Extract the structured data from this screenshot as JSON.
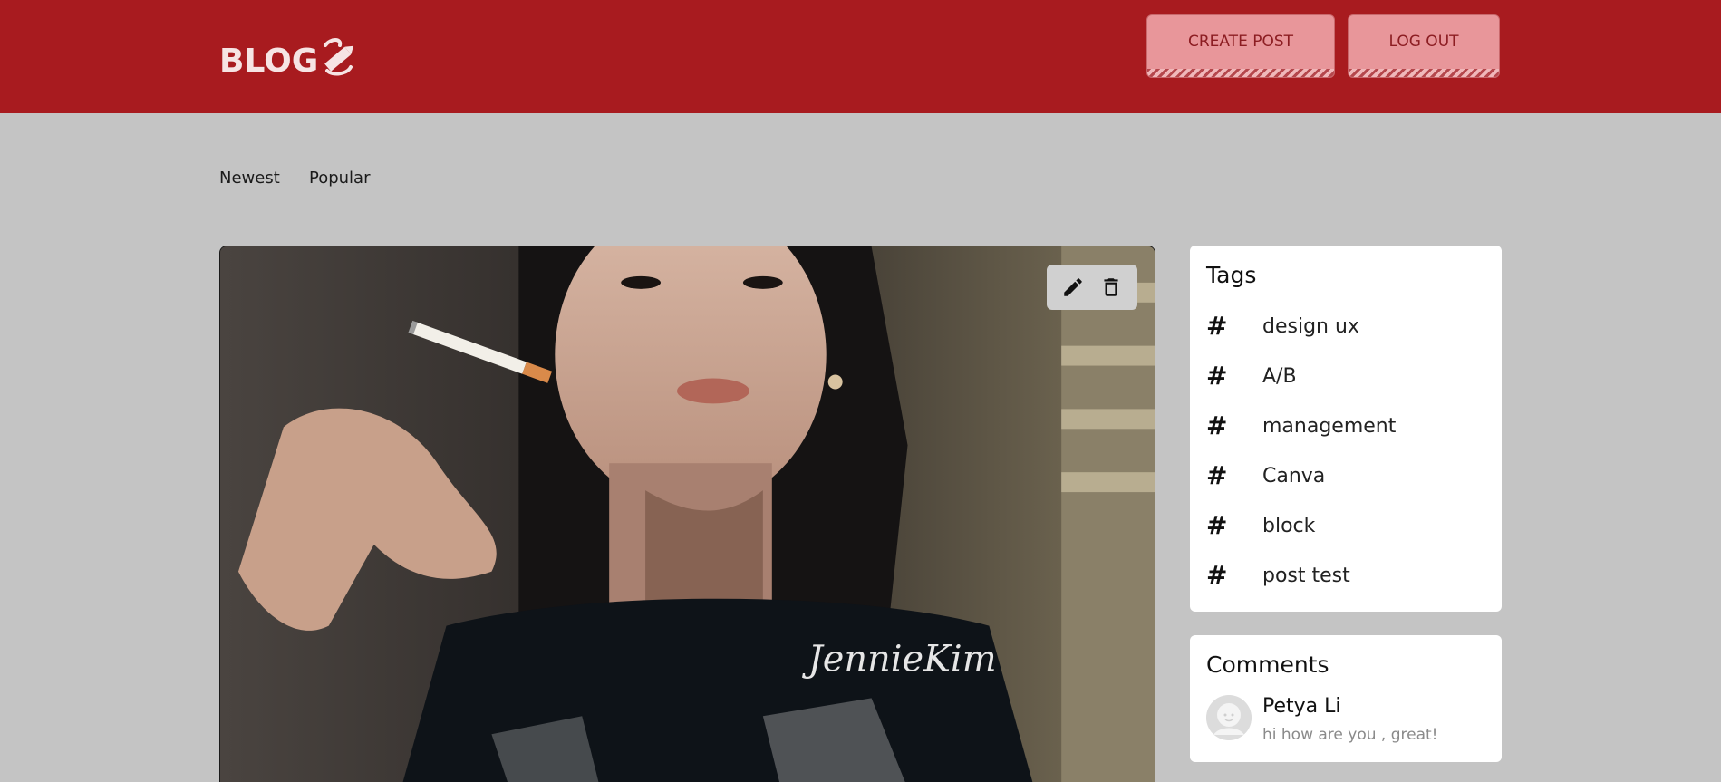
{
  "header": {
    "logo_text": "BLOG",
    "create_post_label": "CREATE POST",
    "logout_label": "LOG OUT",
    "brand_color": "#a81b1f",
    "button_color": "#e8969a"
  },
  "sort_tabs": {
    "newest": "Newest",
    "popular": "Popular"
  },
  "post": {
    "image_caption_text": "JennieKim",
    "actions": [
      "edit-icon",
      "delete-icon"
    ]
  },
  "tags": {
    "title": "Tags",
    "items": [
      {
        "label": "design ux"
      },
      {
        "label": "A/B"
      },
      {
        "label": "management"
      },
      {
        "label": "Canva"
      },
      {
        "label": "block"
      },
      {
        "label": "post test"
      }
    ]
  },
  "comments": {
    "title": "Comments",
    "items": [
      {
        "author": "Petya Li",
        "text": "hi how are you , great!"
      }
    ]
  }
}
